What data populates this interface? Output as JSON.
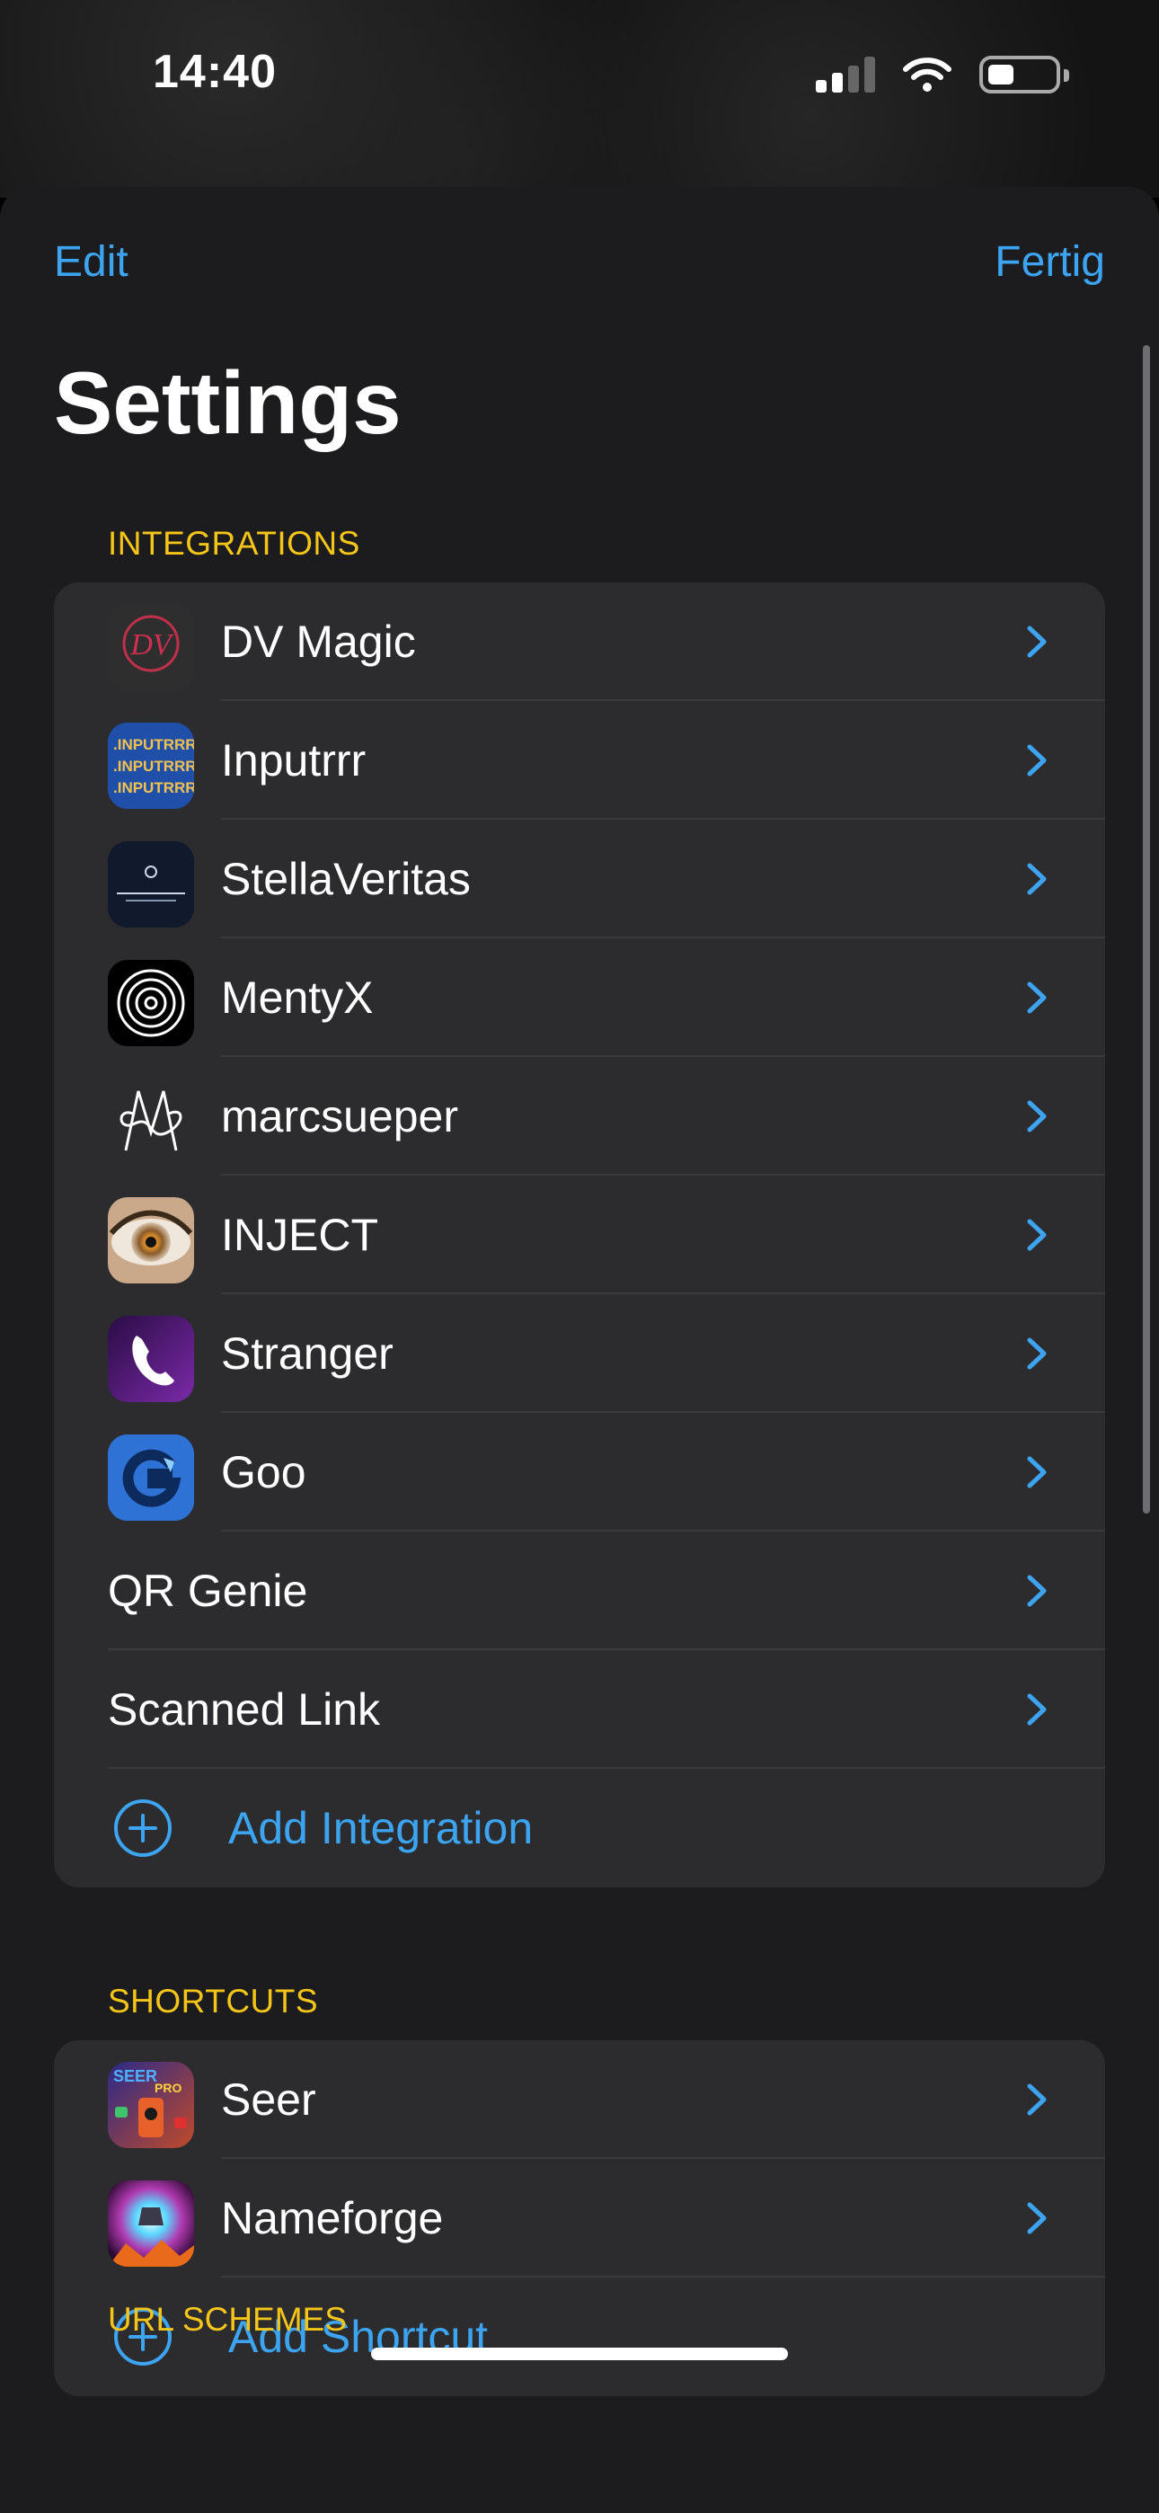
{
  "status_bar": {
    "time": "14:40"
  },
  "nav": {
    "edit_label": "Edit",
    "done_label": "Fertig"
  },
  "page_title": "Settings",
  "integrations": {
    "header": "INTEGRATIONS",
    "items": [
      {
        "label": "DV Magic",
        "icon": "dv-magic-icon"
      },
      {
        "label": "Inputrrr",
        "icon": "inputrrr-icon"
      },
      {
        "label": "StellaVeritas",
        "icon": "stellaveritas-icon"
      },
      {
        "label": "MentyX",
        "icon": "mentyx-icon"
      },
      {
        "label": "marcsueper",
        "icon": "marcsueper-icon"
      },
      {
        "label": "INJECT",
        "icon": "inject-icon"
      },
      {
        "label": "Stranger",
        "icon": "stranger-icon"
      },
      {
        "label": "Goo",
        "icon": "goo-icon"
      },
      {
        "label": "QR Genie"
      },
      {
        "label": "Scanned Link"
      }
    ],
    "add_label": "Add Integration"
  },
  "shortcuts": {
    "header": "SHORTCUTS",
    "items": [
      {
        "label": "Seer",
        "icon": "seer-icon"
      },
      {
        "label": "Nameforge",
        "icon": "nameforge-icon"
      }
    ],
    "add_label": "Add Shortcut"
  },
  "url_schemes": {
    "header": "URL SCHEMES"
  },
  "colors": {
    "accent": "#3ca4f0",
    "section_header": "#f5c518",
    "background": "#1c1c1e",
    "group": "#2c2c2e"
  }
}
